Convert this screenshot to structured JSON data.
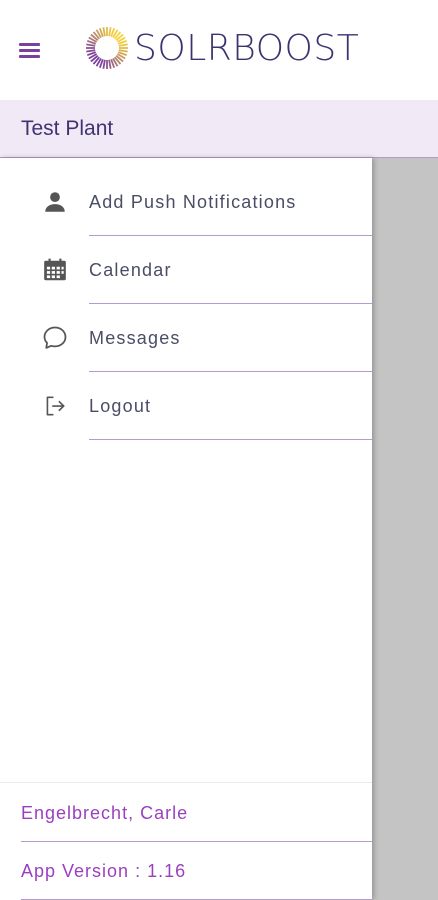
{
  "header": {
    "menu_icon": "hamburger-menu-icon",
    "logo_text": "SOLRBOOST",
    "logo_icon": "sun-ring-logo",
    "colors": {
      "menu": "#7b3fa0",
      "logo_text": "#3d3270",
      "sun_start": "#f6d33a",
      "sun_end": "#7b3fa0"
    }
  },
  "plant": {
    "title": "Test Plant",
    "background": "#f2e9f7"
  },
  "drawer": {
    "items": [
      {
        "label": "Add Push Notifications",
        "icon": "person-icon"
      },
      {
        "label": "Calendar",
        "icon": "calendar-icon"
      },
      {
        "label": "Messages",
        "icon": "chat-bubble-icon"
      },
      {
        "label": "Logout",
        "icon": "logout-icon"
      }
    ]
  },
  "footer": {
    "user_name": "Engelbrecht, Carle",
    "app_version": "App Version : 1.16",
    "accent": "#9b3fc1"
  }
}
